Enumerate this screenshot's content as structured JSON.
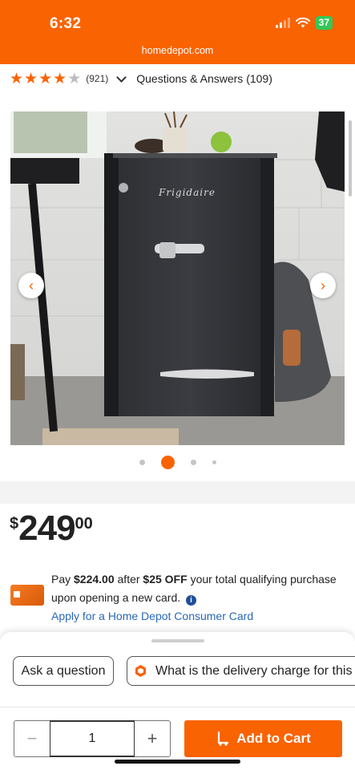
{
  "status_bar": {
    "time": "6:32",
    "battery": "37"
  },
  "browser": {
    "url": "homedepot.com"
  },
  "rating": {
    "stars": 4,
    "max_stars": 5,
    "count": "(921)",
    "qa_label": "Questions & Answers (109)"
  },
  "carousel": {
    "current_index": 2,
    "dots": 4
  },
  "price": {
    "currency": "$",
    "dollars": "249",
    "cents": "00"
  },
  "promo": {
    "pay_label": "Pay",
    "sale_price": "$224.00",
    "after_label": "after",
    "discount": "$25 OFF",
    "rest": "your total qualifying purchase upon opening a new card.",
    "apply_link": "Apply for a Home Depot Consumer Card"
  },
  "questions": {
    "ask_label": "Ask a question",
    "suggested": "What is the delivery charge for this"
  },
  "cart": {
    "quantity": "1",
    "minus": "−",
    "plus": "+",
    "add_label": "Add to Cart"
  },
  "colors": {
    "brand": "#f96302",
    "link": "#2a68b8"
  },
  "icons": [
    "signal-icon",
    "wifi-icon",
    "battery-icon",
    "star-icon",
    "chevron-down-icon",
    "chevron-left-icon",
    "chevron-right-icon",
    "info-icon",
    "hexagon-icon",
    "cart-icon"
  ]
}
